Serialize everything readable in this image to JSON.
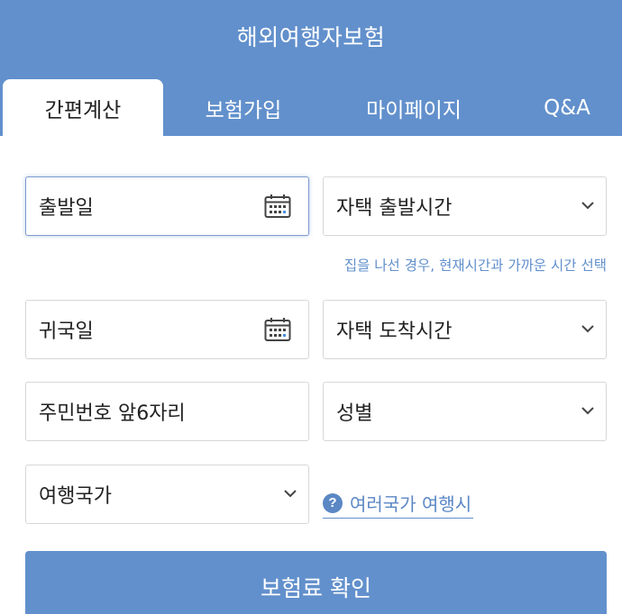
{
  "header": {
    "title": "해외여행자보험"
  },
  "tabs": [
    {
      "label": "간편계산"
    },
    {
      "label": "보험가입"
    },
    {
      "label": "마이페이지"
    },
    {
      "label": "Q&A"
    }
  ],
  "form": {
    "departure_date": "출발일",
    "departure_time": "자택 출발시간",
    "departure_hint": "집을 나선 경우, 현재시간과 가까운 시간 선택",
    "return_date": "귀국일",
    "arrival_time": "자택 도착시간",
    "resident_id": "주민번호 앞6자리",
    "gender": "성별",
    "country": "여행국가",
    "multi_country_link": "여러국가 여행시",
    "help_glyph": "?"
  },
  "submit": {
    "label": "보험료 확인"
  },
  "icons": {
    "calendar": "calendar-icon",
    "chevron": "chevron-down-icon",
    "help": "question-icon"
  },
  "colors": {
    "brand": "#6290cc",
    "link": "#5b87c4",
    "border": "#d7d7d7"
  }
}
